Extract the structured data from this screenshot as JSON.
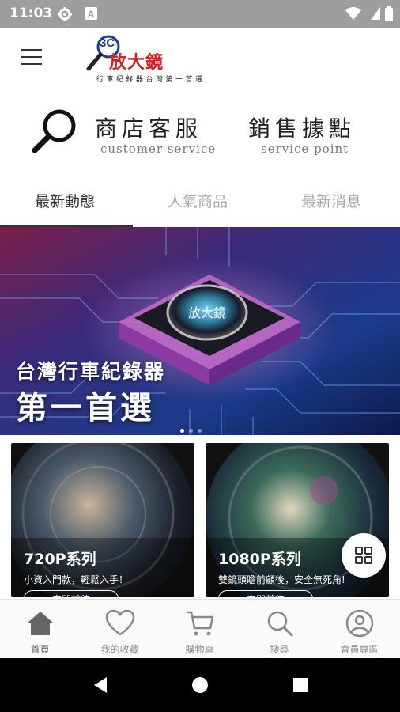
{
  "status_bar": {
    "time": "11:03",
    "icons": [
      "gear-icon",
      "a-icon",
      "wifi-icon",
      "battery-icon"
    ]
  },
  "header": {
    "logo": {
      "badge": "3C",
      "name": "放大鏡",
      "tagline": "行車紀錄器台灣第一首選"
    }
  },
  "service_links": [
    {
      "title": "商店客服",
      "subtitle": "customer service"
    },
    {
      "title": "銷售據點",
      "subtitle": "service point"
    }
  ],
  "tabs": [
    {
      "label": "最新動態",
      "active": true
    },
    {
      "label": "人氣商品",
      "active": false
    },
    {
      "label": "最新消息",
      "active": false
    }
  ],
  "banner": {
    "line1": "台灣行車紀錄器",
    "line2": "第一首選",
    "chip_text": "放大鏡",
    "slide_count": 3,
    "active_slide": 1
  },
  "cards": [
    {
      "title": "720P系列",
      "subtitle": "小資入門款，輕鬆入手！",
      "button": "立即前往"
    },
    {
      "title": "1080P系列",
      "subtitle": "雙鏡頭瞻前顧後，安全無死角!",
      "button": "立即前往"
    }
  ],
  "bottom_nav": [
    {
      "label": "首頁",
      "icon": "home-icon",
      "active": true
    },
    {
      "label": "我的收藏",
      "icon": "heart-icon",
      "active": false
    },
    {
      "label": "購物車",
      "icon": "cart-icon",
      "active": false
    },
    {
      "label": "搜尋",
      "icon": "search-icon",
      "active": false
    },
    {
      "label": "會員專區",
      "icon": "user-icon",
      "active": false
    }
  ],
  "colors": {
    "brand_red": "#d42020",
    "brand_blue": "#1a3a8a",
    "status_bar": "#9e9e9e",
    "system_nav": "#000000"
  }
}
